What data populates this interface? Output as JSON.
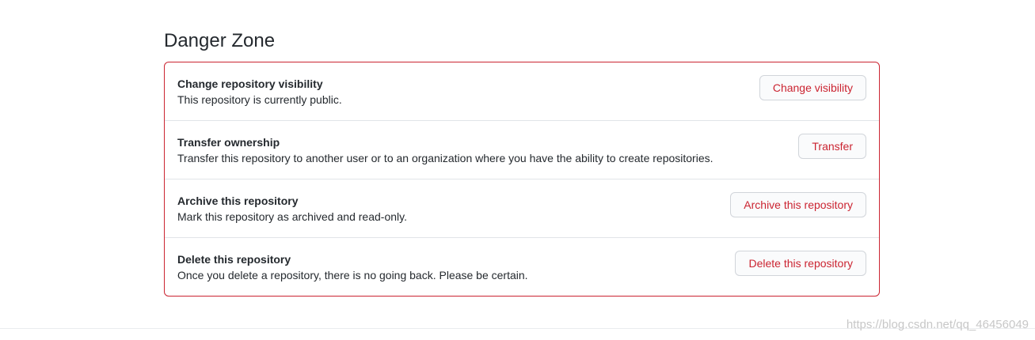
{
  "danger_zone": {
    "title": "Danger Zone",
    "rows": [
      {
        "title": "Change repository visibility",
        "description": "This repository is currently public.",
        "button": "Change visibility"
      },
      {
        "title": "Transfer ownership",
        "description": "Transfer this repository to another user or to an organization where you have the ability to create repositories.",
        "button": "Transfer"
      },
      {
        "title": "Archive this repository",
        "description": "Mark this repository as archived and read-only.",
        "button": "Archive this repository"
      },
      {
        "title": "Delete this repository",
        "description": "Once you delete a repository, there is no going back. Please be certain.",
        "button": "Delete this repository"
      }
    ]
  },
  "watermark": "https://blog.csdn.net/qq_46456049",
  "colors": {
    "danger": "#cb2431",
    "text": "#24292e",
    "border": "#e1e4e8"
  }
}
